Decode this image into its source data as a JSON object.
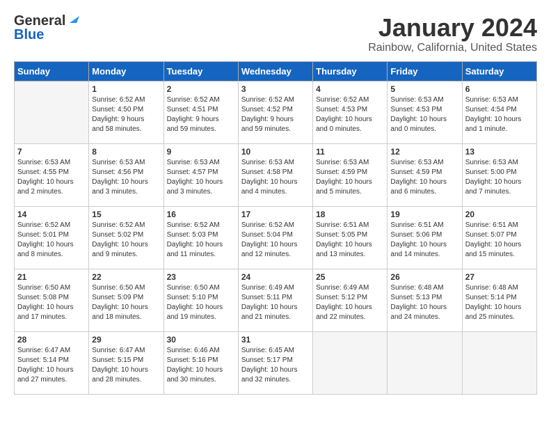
{
  "logo": {
    "general": "General",
    "blue": "Blue"
  },
  "title": "January 2024",
  "subtitle": "Rainbow, California, United States",
  "days_of_week": [
    "Sunday",
    "Monday",
    "Tuesday",
    "Wednesday",
    "Thursday",
    "Friday",
    "Saturday"
  ],
  "weeks": [
    [
      {
        "day": "",
        "info": ""
      },
      {
        "day": "1",
        "info": "Sunrise: 6:52 AM\nSunset: 4:50 PM\nDaylight: 9 hours\nand 58 minutes."
      },
      {
        "day": "2",
        "info": "Sunrise: 6:52 AM\nSunset: 4:51 PM\nDaylight: 9 hours\nand 59 minutes."
      },
      {
        "day": "3",
        "info": "Sunrise: 6:52 AM\nSunset: 4:52 PM\nDaylight: 9 hours\nand 59 minutes."
      },
      {
        "day": "4",
        "info": "Sunrise: 6:52 AM\nSunset: 4:53 PM\nDaylight: 10 hours\nand 0 minutes."
      },
      {
        "day": "5",
        "info": "Sunrise: 6:53 AM\nSunset: 4:53 PM\nDaylight: 10 hours\nand 0 minutes."
      },
      {
        "day": "6",
        "info": "Sunrise: 6:53 AM\nSunset: 4:54 PM\nDaylight: 10 hours\nand 1 minute."
      }
    ],
    [
      {
        "day": "7",
        "info": "Sunrise: 6:53 AM\nSunset: 4:55 PM\nDaylight: 10 hours\nand 2 minutes."
      },
      {
        "day": "8",
        "info": "Sunrise: 6:53 AM\nSunset: 4:56 PM\nDaylight: 10 hours\nand 3 minutes."
      },
      {
        "day": "9",
        "info": "Sunrise: 6:53 AM\nSunset: 4:57 PM\nDaylight: 10 hours\nand 3 minutes."
      },
      {
        "day": "10",
        "info": "Sunrise: 6:53 AM\nSunset: 4:58 PM\nDaylight: 10 hours\nand 4 minutes."
      },
      {
        "day": "11",
        "info": "Sunrise: 6:53 AM\nSunset: 4:59 PM\nDaylight: 10 hours\nand 5 minutes."
      },
      {
        "day": "12",
        "info": "Sunrise: 6:53 AM\nSunset: 4:59 PM\nDaylight: 10 hours\nand 6 minutes."
      },
      {
        "day": "13",
        "info": "Sunrise: 6:53 AM\nSunset: 5:00 PM\nDaylight: 10 hours\nand 7 minutes."
      }
    ],
    [
      {
        "day": "14",
        "info": "Sunrise: 6:52 AM\nSunset: 5:01 PM\nDaylight: 10 hours\nand 8 minutes."
      },
      {
        "day": "15",
        "info": "Sunrise: 6:52 AM\nSunset: 5:02 PM\nDaylight: 10 hours\nand 9 minutes."
      },
      {
        "day": "16",
        "info": "Sunrise: 6:52 AM\nSunset: 5:03 PM\nDaylight: 10 hours\nand 11 minutes."
      },
      {
        "day": "17",
        "info": "Sunrise: 6:52 AM\nSunset: 5:04 PM\nDaylight: 10 hours\nand 12 minutes."
      },
      {
        "day": "18",
        "info": "Sunrise: 6:51 AM\nSunset: 5:05 PM\nDaylight: 10 hours\nand 13 minutes."
      },
      {
        "day": "19",
        "info": "Sunrise: 6:51 AM\nSunset: 5:06 PM\nDaylight: 10 hours\nand 14 minutes."
      },
      {
        "day": "20",
        "info": "Sunrise: 6:51 AM\nSunset: 5:07 PM\nDaylight: 10 hours\nand 15 minutes."
      }
    ],
    [
      {
        "day": "21",
        "info": "Sunrise: 6:50 AM\nSunset: 5:08 PM\nDaylight: 10 hours\nand 17 minutes."
      },
      {
        "day": "22",
        "info": "Sunrise: 6:50 AM\nSunset: 5:09 PM\nDaylight: 10 hours\nand 18 minutes."
      },
      {
        "day": "23",
        "info": "Sunrise: 6:50 AM\nSunset: 5:10 PM\nDaylight: 10 hours\nand 19 minutes."
      },
      {
        "day": "24",
        "info": "Sunrise: 6:49 AM\nSunset: 5:11 PM\nDaylight: 10 hours\nand 21 minutes."
      },
      {
        "day": "25",
        "info": "Sunrise: 6:49 AM\nSunset: 5:12 PM\nDaylight: 10 hours\nand 22 minutes."
      },
      {
        "day": "26",
        "info": "Sunrise: 6:48 AM\nSunset: 5:13 PM\nDaylight: 10 hours\nand 24 minutes."
      },
      {
        "day": "27",
        "info": "Sunrise: 6:48 AM\nSunset: 5:14 PM\nDaylight: 10 hours\nand 25 minutes."
      }
    ],
    [
      {
        "day": "28",
        "info": "Sunrise: 6:47 AM\nSunset: 5:14 PM\nDaylight: 10 hours\nand 27 minutes."
      },
      {
        "day": "29",
        "info": "Sunrise: 6:47 AM\nSunset: 5:15 PM\nDaylight: 10 hours\nand 28 minutes."
      },
      {
        "day": "30",
        "info": "Sunrise: 6:46 AM\nSunset: 5:16 PM\nDaylight: 10 hours\nand 30 minutes."
      },
      {
        "day": "31",
        "info": "Sunrise: 6:45 AM\nSunset: 5:17 PM\nDaylight: 10 hours\nand 32 minutes."
      },
      {
        "day": "",
        "info": ""
      },
      {
        "day": "",
        "info": ""
      },
      {
        "day": "",
        "info": ""
      }
    ]
  ]
}
